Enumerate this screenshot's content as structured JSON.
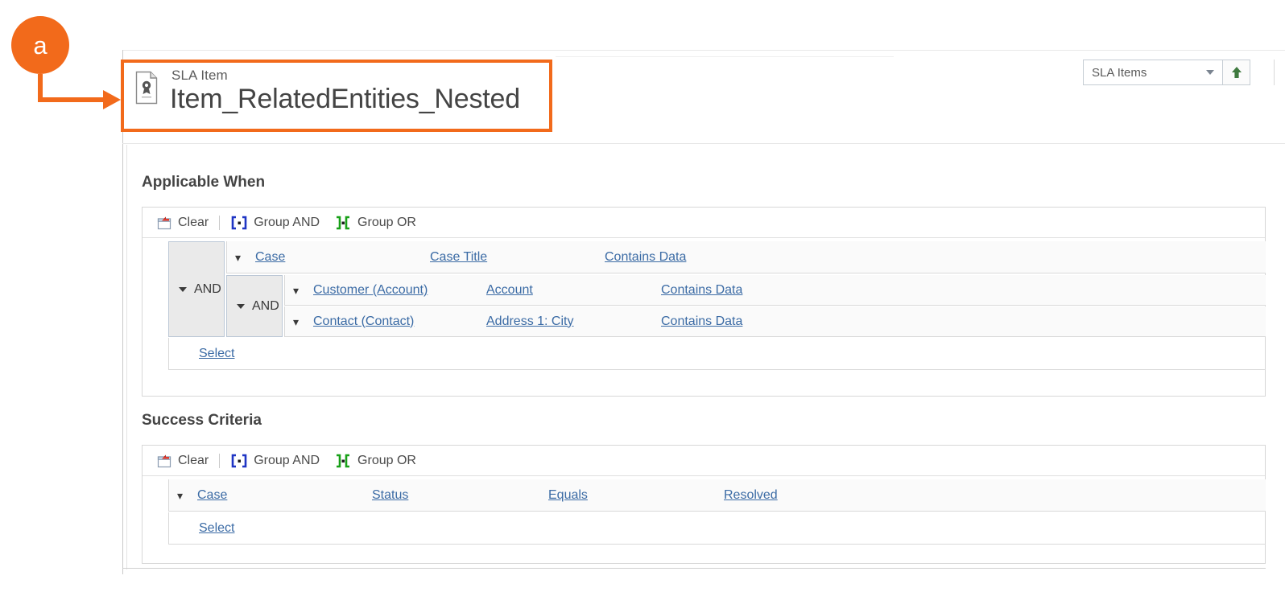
{
  "annotation": {
    "badge_label": "a",
    "badge_color": "#F26A1B",
    "highlight_color": "#F26A1B"
  },
  "header": {
    "icon": "sla-item-document-icon",
    "entity_label": "SLA Item",
    "record_title": "Item_RelatedEntities_Nested"
  },
  "lookup": {
    "value": "SLA Items",
    "caret_icon": "chevron-down-icon",
    "nav_up_icon": "arrow-up-icon"
  },
  "toolbar": {
    "clear_label": "Clear",
    "clear_icon": "clear-criteria-icon",
    "group_and_label": "Group AND",
    "group_and_icon": "group-and-bracket-icon",
    "group_or_label": "Group OR",
    "group_or_icon": "group-or-bracket-icon"
  },
  "sections": [
    {
      "title": "Applicable When",
      "select_label": "Select",
      "groups": {
        "outer_operator": "AND",
        "inner_operator": "AND"
      },
      "rows": [
        {
          "chevron_icon": "chevron-down-icon",
          "entity": "Case",
          "attribute": "Case Title",
          "operator": "Contains Data",
          "value": "",
          "nested": false
        },
        {
          "chevron_icon": "chevron-down-icon",
          "entity": "Customer (Account)",
          "attribute": "Account",
          "operator": "Contains Data",
          "value": "",
          "nested": true
        },
        {
          "chevron_icon": "chevron-down-icon",
          "entity": "Contact (Contact)",
          "attribute": "Address 1: City",
          "operator": "Contains Data",
          "value": "",
          "nested": true
        }
      ]
    },
    {
      "title": "Success Criteria",
      "select_label": "Select",
      "groups": {
        "outer_operator": "",
        "inner_operator": ""
      },
      "rows": [
        {
          "chevron_icon": "chevron-down-icon",
          "entity": "Case",
          "attribute": "Status",
          "operator": "Equals",
          "value": "Resolved",
          "nested": false
        }
      ]
    }
  ]
}
